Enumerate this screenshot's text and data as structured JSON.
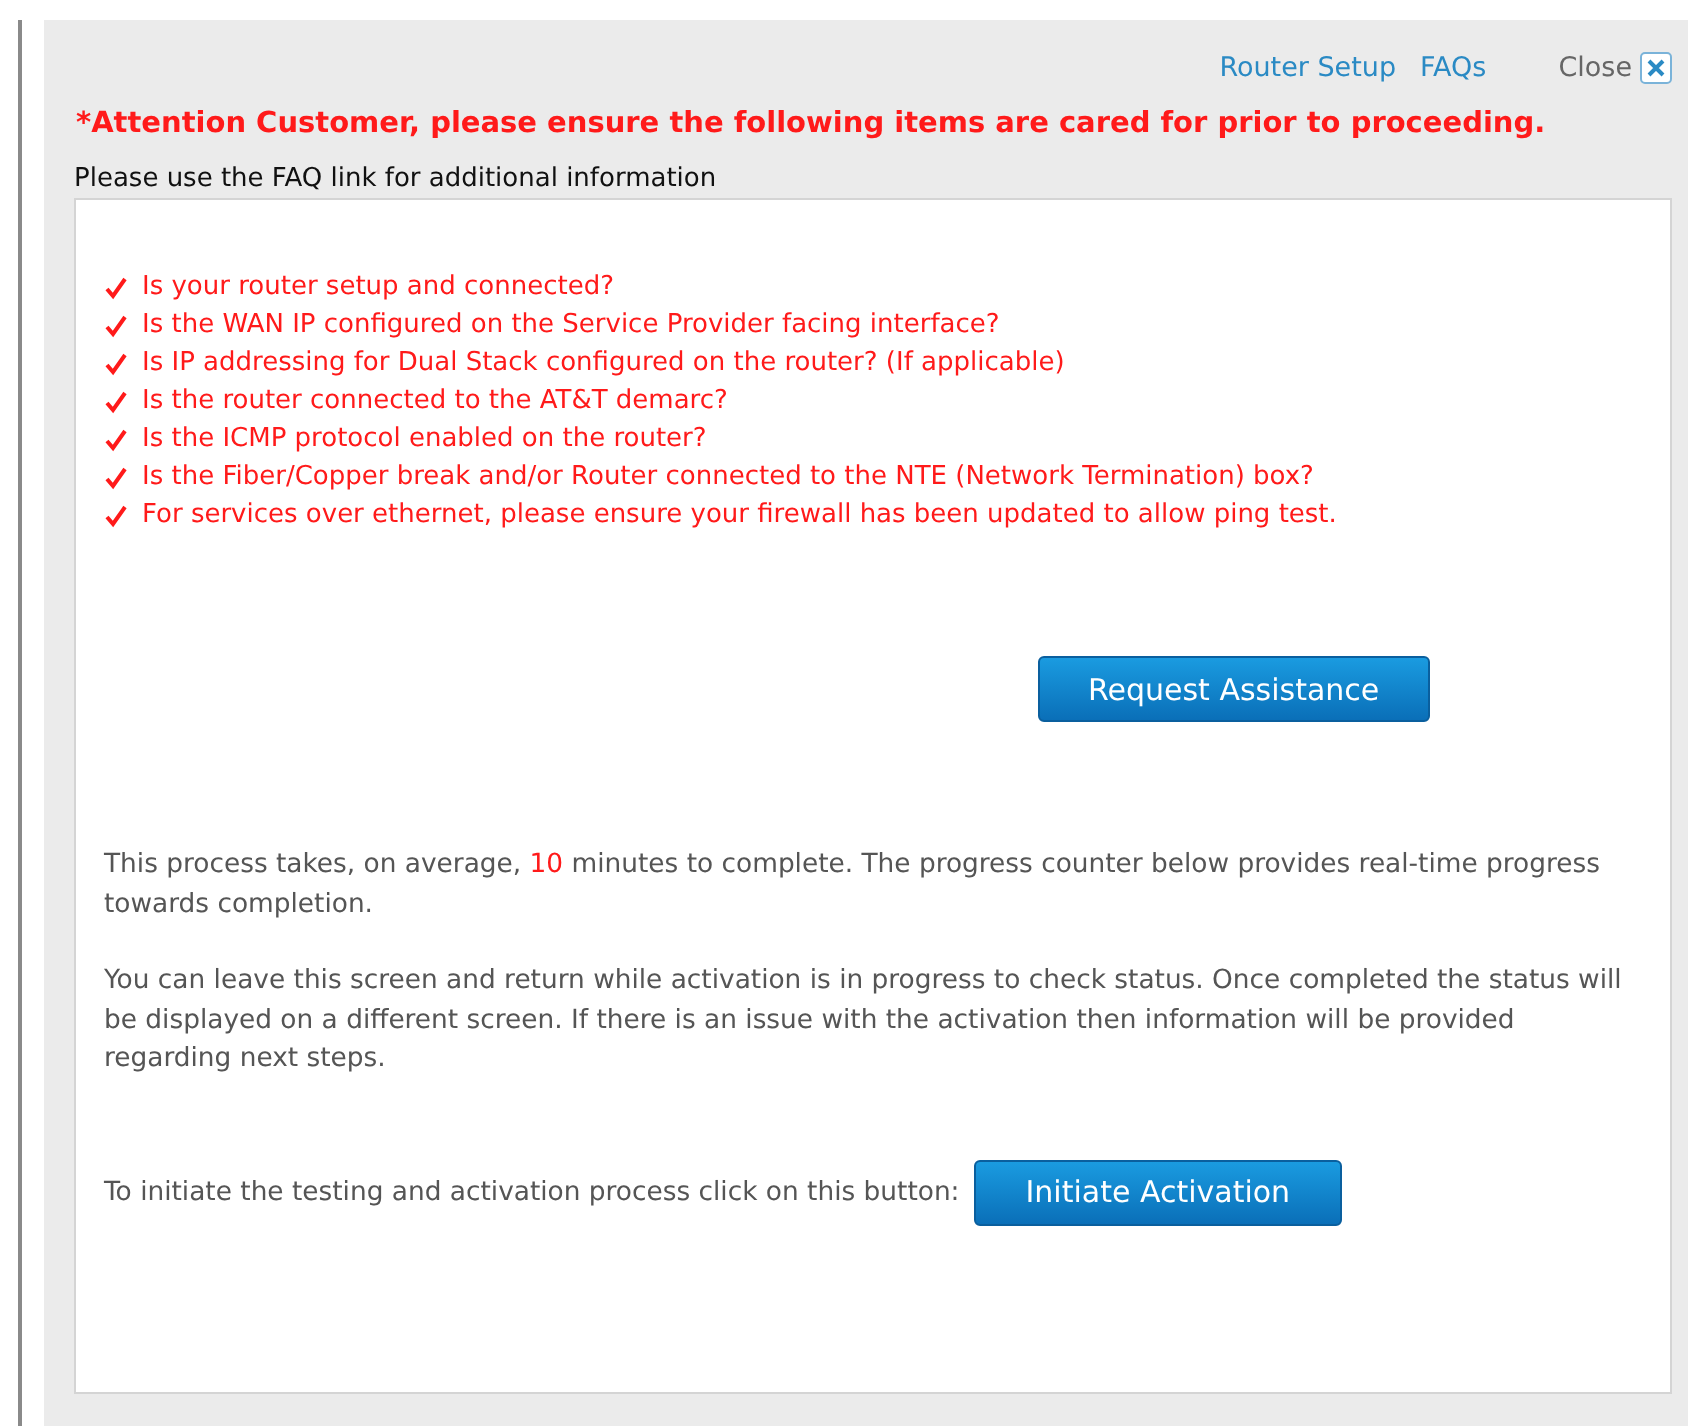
{
  "header_links": [
    {
      "label": "Router Setup"
    },
    {
      "label": "FAQs"
    }
  ],
  "close": {
    "label": "Close"
  },
  "attention": "*Attention Customer, please ensure the following items are cared for prior to proceeding.",
  "faq_note": "Please use the FAQ link for additional information",
  "checklist": [
    {
      "text": "Is your router setup and connected?"
    },
    {
      "text": "Is the WAN IP configured on the Service Provider facing interface?"
    },
    {
      "text": "Is IP addressing for Dual Stack configured on the router? (If applicable)"
    },
    {
      "text": "Is the router connected to the AT&T demarc?"
    },
    {
      "text": "Is the ICMP protocol enabled on the router?"
    },
    {
      "text": "Is the Fiber/Copper break and/or Router connected to the NTE (Network Termination) box?"
    },
    {
      "text": "For services over ethernet, please ensure your firewall has been updated to allow ping test."
    }
  ],
  "request_button": "Request Assistance",
  "paragraphs": [
    {
      "parts": [
        {
          "kind": "plain",
          "text": "This process takes, on average, "
        },
        {
          "kind": "highlight",
          "text": "10"
        },
        {
          "kind": "plain",
          "text": " minutes to complete. The progress counter below provides real-time progress towards completion."
        }
      ]
    },
    {
      "parts": [
        {
          "kind": "plain",
          "text": "You can leave this screen and return while activation is in progress to check status. Once completed the status will be displayed on a different screen. If there is an issue with the activation then information will be provided regarding next steps."
        }
      ]
    }
  ],
  "initiate": {
    "prompt": "To initiate the testing and activation process click on this button:",
    "button": "Initiate Activation"
  }
}
